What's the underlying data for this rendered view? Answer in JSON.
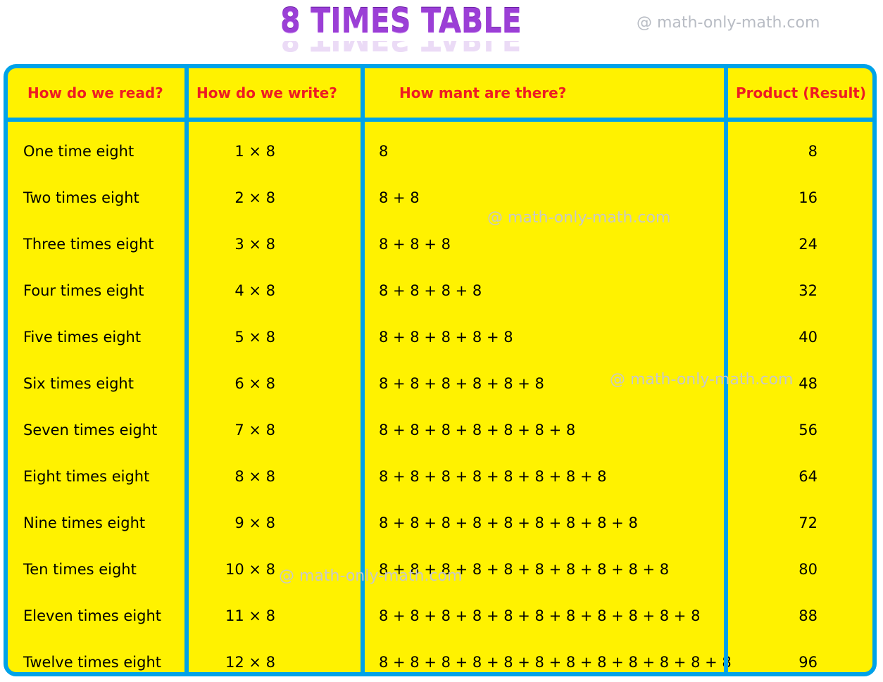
{
  "title": "8 TIMES TABLE",
  "watermark": "@ math-only-math.com",
  "colors": {
    "title": "#9b3fd6",
    "header_text": "#ed1c24",
    "table_fill": "#fff200",
    "border": "#00a2e8",
    "body_text": "#000000",
    "watermark": "#c0c0c0"
  },
  "table": {
    "headers": {
      "read": "How do we read?",
      "write": "How do we write?",
      "count": "How mant are there?",
      "product": "Product (Result)"
    },
    "rows": [
      {
        "read": "One time eight",
        "write": "1 × 8",
        "count": "8",
        "product": "8"
      },
      {
        "read": "Two times eight",
        "write": "2 × 8",
        "count": "8 + 8",
        "product": "16"
      },
      {
        "read": "Three times eight",
        "write": "3 × 8",
        "count": "8 + 8 + 8",
        "product": "24"
      },
      {
        "read": "Four times eight",
        "write": "4 × 8",
        "count": "8 + 8 + 8 + 8",
        "product": "32"
      },
      {
        "read": "Five times eight",
        "write": "5 × 8",
        "count": "8 + 8 + 8 + 8 + 8",
        "product": "40"
      },
      {
        "read": "Six times eight",
        "write": "6 × 8",
        "count": "8 + 8 + 8 + 8 + 8 + 8",
        "product": "48"
      },
      {
        "read": "Seven times eight",
        "write": "7 × 8",
        "count": "8 + 8 + 8 + 8 + 8 + 8 + 8",
        "product": "56"
      },
      {
        "read": "Eight times eight",
        "write": "8 × 8",
        "count": "8 + 8 + 8 + 8 + 8 + 8 + 8 + 8",
        "product": "64"
      },
      {
        "read": "Nine times eight",
        "write": "9 × 8",
        "count": "8 + 8 + 8 + 8 + 8 + 8 + 8 + 8 + 8",
        "product": "72"
      },
      {
        "read": "Ten times eight",
        "write": "10 × 8",
        "count": "8 + 8 + 8 + 8 + 8 + 8 + 8 + 8 + 8 + 8",
        "product": "80"
      },
      {
        "read": "Eleven times eight",
        "write": "11 × 8",
        "count": "8 + 8 + 8 + 8 + 8 + 8 + 8 + 8 + 8 + 8 + 8",
        "product": "88"
      },
      {
        "read": "Twelve times eight",
        "write": "12 × 8",
        "count": "8 + 8 + 8 + 8 + 8 + 8 + 8 + 8 + 8 + 8 + 8 + 8",
        "product": "96"
      }
    ]
  }
}
